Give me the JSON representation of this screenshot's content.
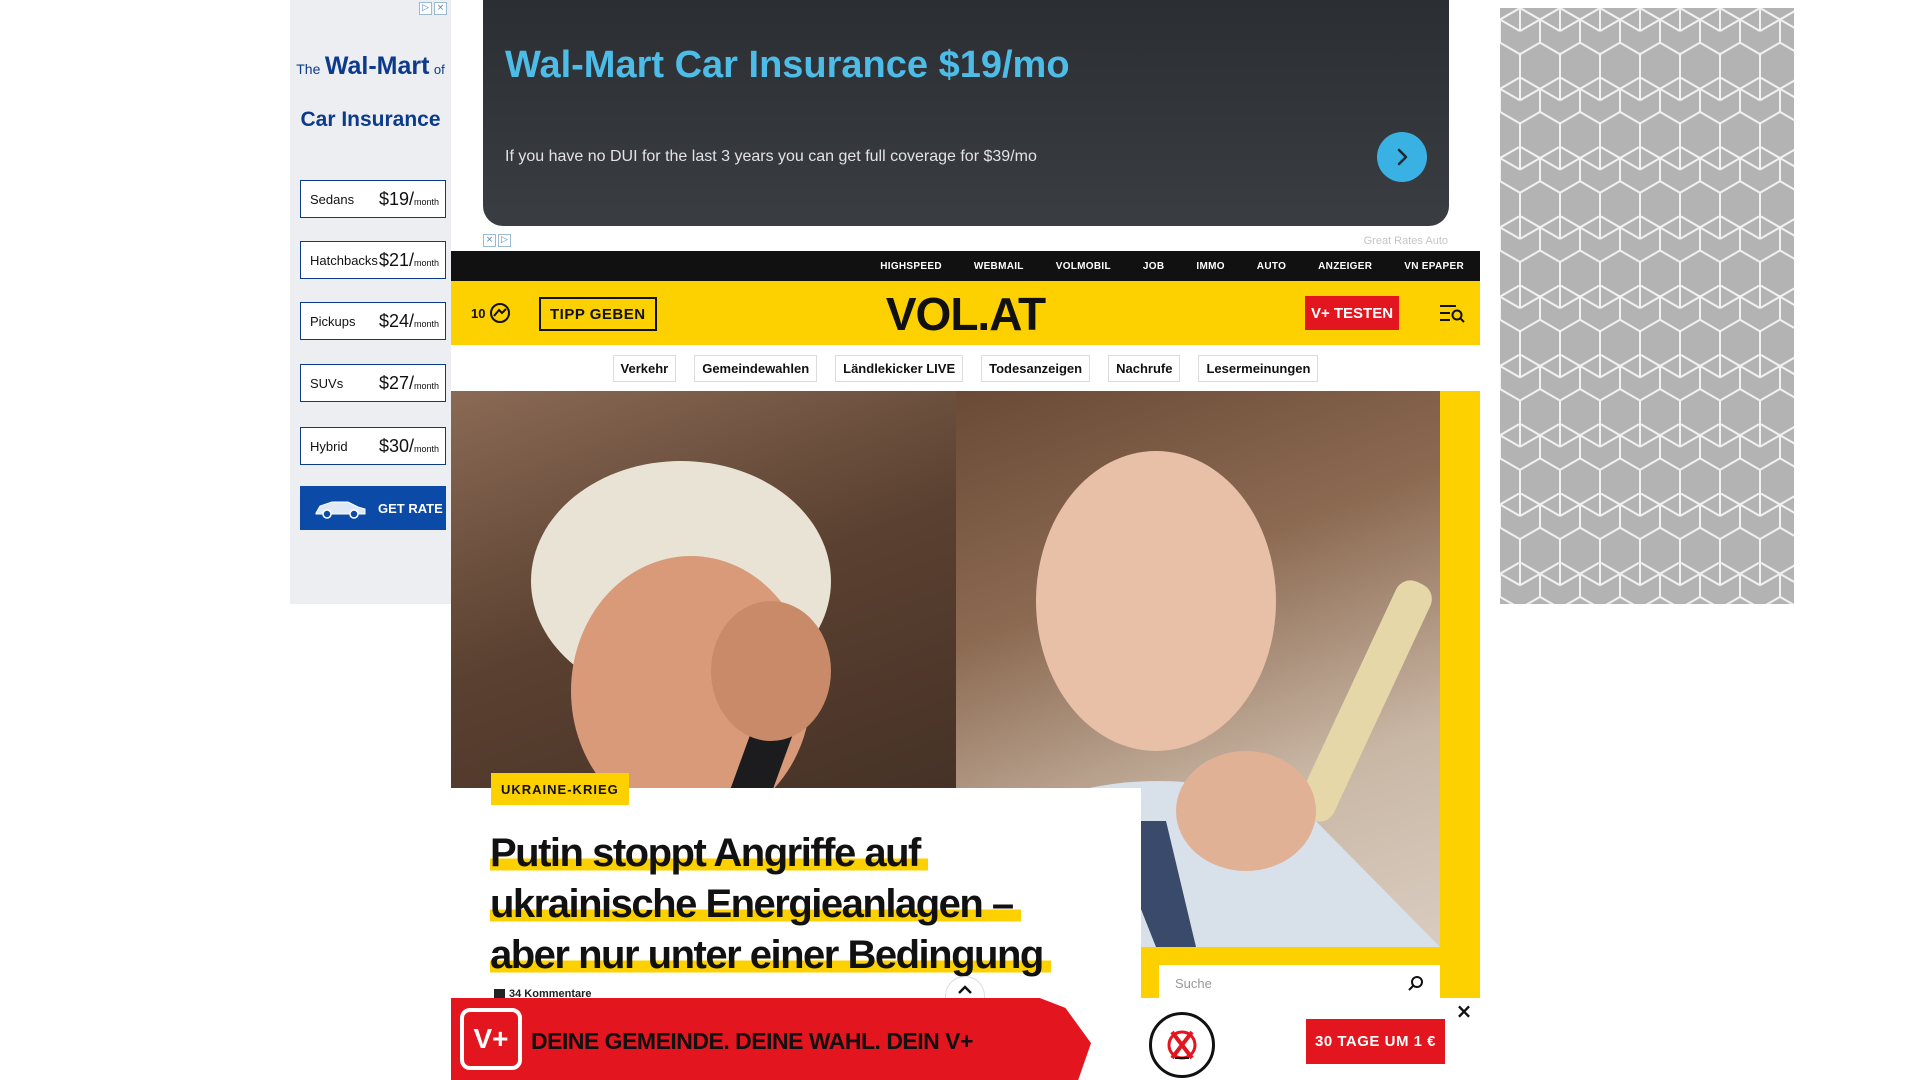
{
  "left_ad": {
    "brand_the": "The",
    "brand_name": "Wal-Mart",
    "brand_of": "of",
    "subtitle": "Car Insurance",
    "rates": [
      {
        "name": "Sedans",
        "price": "$19/",
        "unit": "month"
      },
      {
        "name": "Hatchbacks",
        "price": "$21/",
        "unit": "month"
      },
      {
        "name": "Pickups",
        "price": "$24/",
        "unit": "month"
      },
      {
        "name": "SUVs",
        "price": "$27/",
        "unit": "month"
      },
      {
        "name": "Hybrid",
        "price": "$30/",
        "unit": "month"
      }
    ],
    "cta": "GET RATE"
  },
  "top_ad": {
    "headline": "Wal-Mart Car Insurance $19/mo",
    "description": "If you have no DUI for the last 3 years you can get full coverage for $39/mo",
    "sponsor": "Great Rates Auto"
  },
  "topnav": [
    "HIGHSPEED",
    "WEBMAIL",
    "VOLMOBIL",
    "JOB",
    "IMMO",
    "AUTO",
    "ANZEIGER",
    "VN EPAPER"
  ],
  "header": {
    "temperature": "10",
    "tipp_button": "TIPP GEBEN",
    "logo": "VOL.AT",
    "vplus_button": "V+ TESTEN"
  },
  "subnav": [
    "Verkehr",
    "Gemeindewahlen",
    "Ländlekicker LIVE",
    "Todesanzeigen",
    "Nachrufe",
    "Lesermeinungen"
  ],
  "article": {
    "category": "UKRAINE-KRIEG",
    "headline_lines": [
      "Putin stoppt Angriffe auf",
      "ukrainische Energieanlagen –",
      "aber nur unter einer Bedingung"
    ],
    "comments": "34 Kommentare"
  },
  "search": {
    "placeholder": "Suche"
  },
  "sticky": {
    "logo": "V+",
    "text": "DEINE GEMEINDE. DEINE WAHL. DEIN V+",
    "cta": "30 TAGE UM 1 €",
    "close": "×"
  },
  "colors": {
    "brand_yellow": "#fdd000",
    "brand_red": "#e3151f",
    "ad_blue": "#0d3b8c",
    "ad_cyan": "#4dbde8"
  }
}
